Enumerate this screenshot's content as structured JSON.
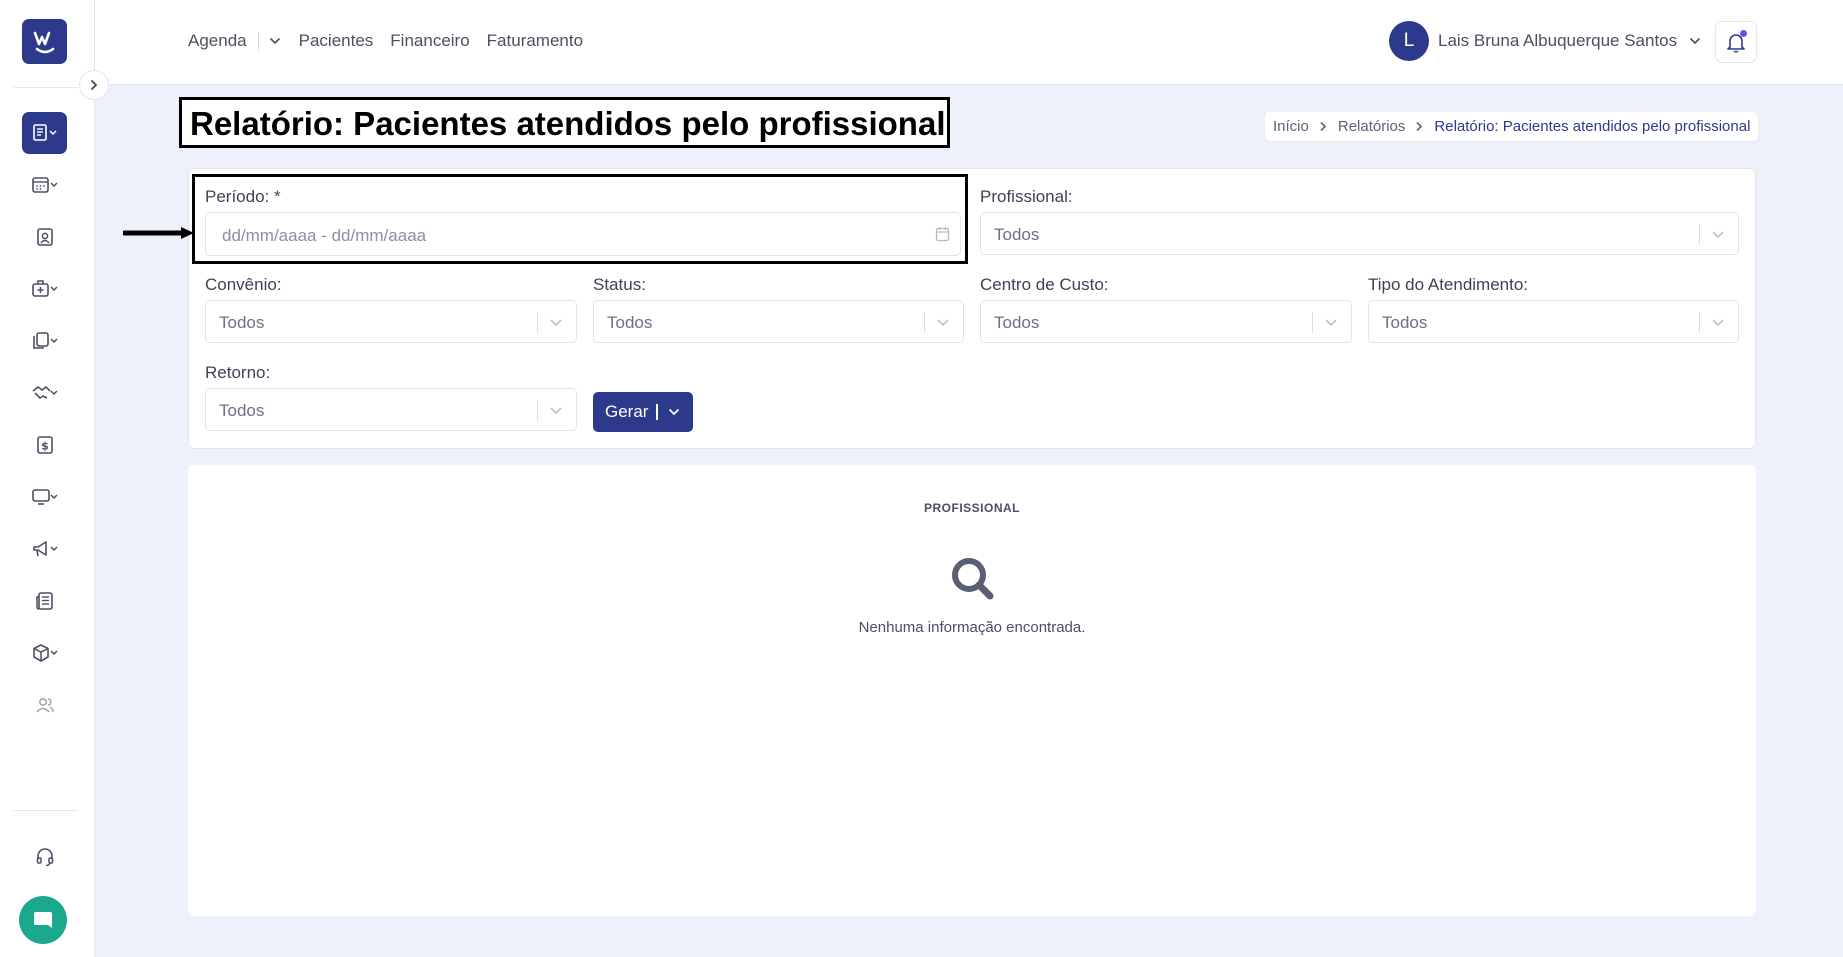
{
  "topnav": {
    "agenda": "Agenda",
    "pacientes": "Pacientes",
    "financeiro": "Financeiro",
    "faturamento": "Faturamento"
  },
  "user": {
    "initial": "L",
    "name": "Lais Bruna Albuquerque Santos"
  },
  "page": {
    "title": "Relatório: Pacientes atendidos pelo profissional"
  },
  "breadcrumb": {
    "home": "Início",
    "reports": "Relatórios",
    "current": "Relatório: Pacientes atendidos pelo profissional"
  },
  "filters": {
    "periodo": {
      "label": "Período: *",
      "placeholder": "dd/mm/aaaa - dd/mm/aaaa"
    },
    "profissional": {
      "label": "Profissional:",
      "value": "Todos"
    },
    "convenio": {
      "label": "Convênio:",
      "value": "Todos"
    },
    "status": {
      "label": "Status:",
      "value": "Todos"
    },
    "centro_custo": {
      "label": "Centro de Custo:",
      "value": "Todos"
    },
    "tipo_atendimento": {
      "label": "Tipo do Atendimento:",
      "value": "Todos"
    },
    "retorno": {
      "label": "Retorno:",
      "value": "Todos"
    },
    "gerar_label": "Gerar"
  },
  "results": {
    "header": "PROFISSIONAL",
    "empty_message": "Nenhuma informação encontrada."
  },
  "colors": {
    "primary": "#2d3a8c",
    "chat": "#1aa88f",
    "notification_dot": "#5a55e8"
  },
  "sidebar_icons": [
    "reports-icon",
    "calendar-icon",
    "patient-badge-icon",
    "clinic-icon",
    "documents-icon",
    "handshake-icon",
    "dollar-icon",
    "monitor-icon",
    "megaphone-icon",
    "newspaper-icon",
    "box-icon",
    "users-icon",
    "headset-icon",
    "chat-icon"
  ]
}
